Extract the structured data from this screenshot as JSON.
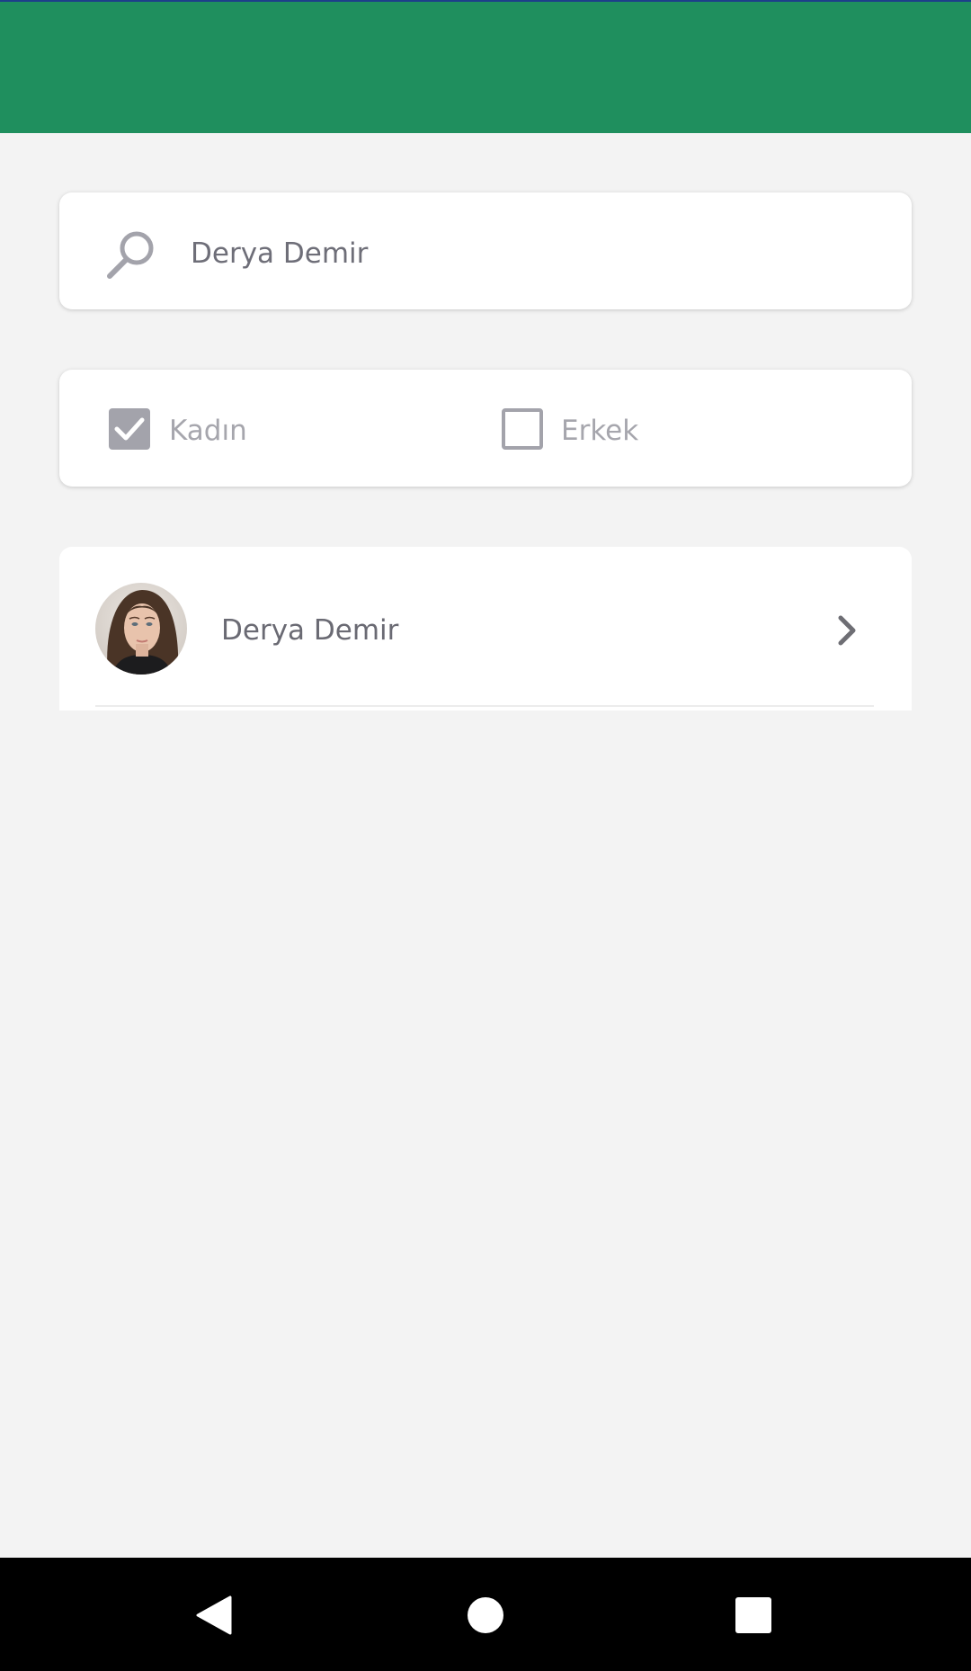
{
  "search": {
    "value": "Derya Demir",
    "icon": "search-icon"
  },
  "filters": {
    "female": {
      "label": "Kadın",
      "checked": true
    },
    "male": {
      "label": "Erkek",
      "checked": false
    }
  },
  "results": [
    {
      "name": "Derya Demir",
      "icon": "chevron-right-icon"
    }
  ],
  "colors": {
    "header": "#1f8f5e",
    "background": "#f3f3f3",
    "checkbox": "#a3a3ab",
    "text": "#6e6e78"
  },
  "navbar": {
    "icons": [
      "back-icon",
      "home-icon",
      "recents-icon"
    ]
  }
}
